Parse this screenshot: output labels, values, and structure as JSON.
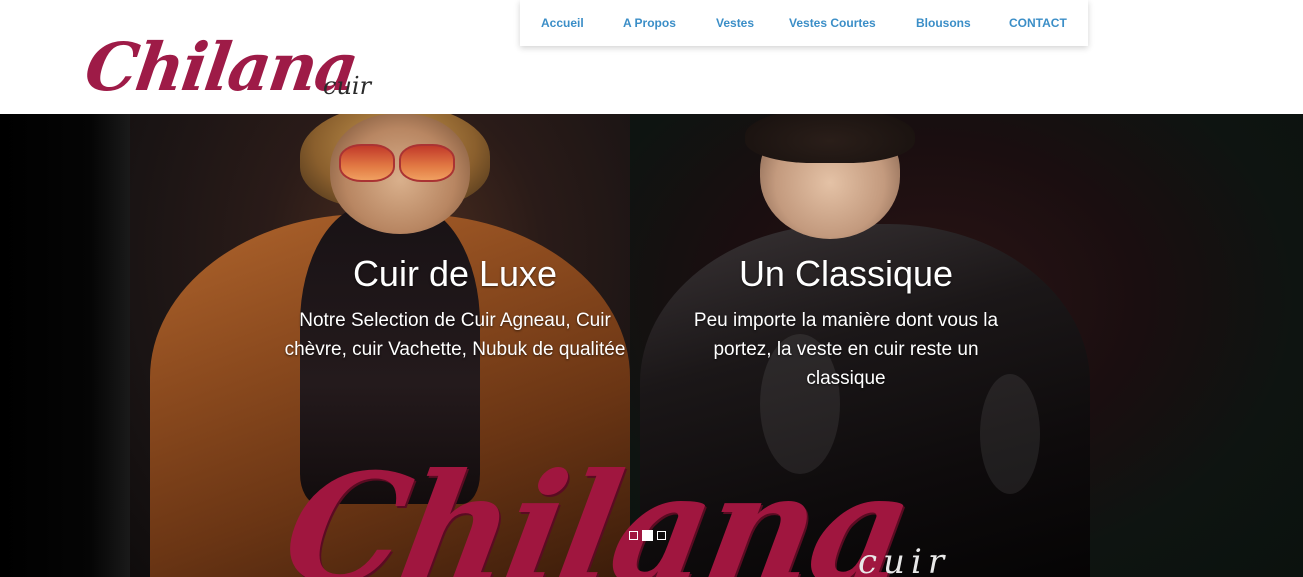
{
  "logo": {
    "main": "Chilana",
    "sub": "cuir"
  },
  "nav": {
    "items": [
      {
        "label": "Accueil"
      },
      {
        "label": "A Propos"
      },
      {
        "label": "Vestes"
      },
      {
        "label": "Vestes Courtes"
      },
      {
        "label": "Blousons"
      },
      {
        "label": "CONTACT"
      }
    ]
  },
  "hero": {
    "slides": [
      {
        "title": "Cuir de Luxe",
        "text": "Notre Selection de Cuir Agneau, Cuir chèvre, cuir Vachette, Nubuk de qualitée"
      },
      {
        "title": "Un Classique",
        "text": "Peu importe la manière dont vous la portez, la veste en cuir reste un classique"
      }
    ],
    "watermark_logo": {
      "main": "Chilana",
      "sub": "cuir"
    },
    "slider": {
      "count": 3,
      "active_index": 1
    }
  },
  "colors": {
    "brand": "#9e1b47",
    "nav_link": "#3b8ec7"
  },
  "icons": [
    "slider-dot-icon"
  ]
}
